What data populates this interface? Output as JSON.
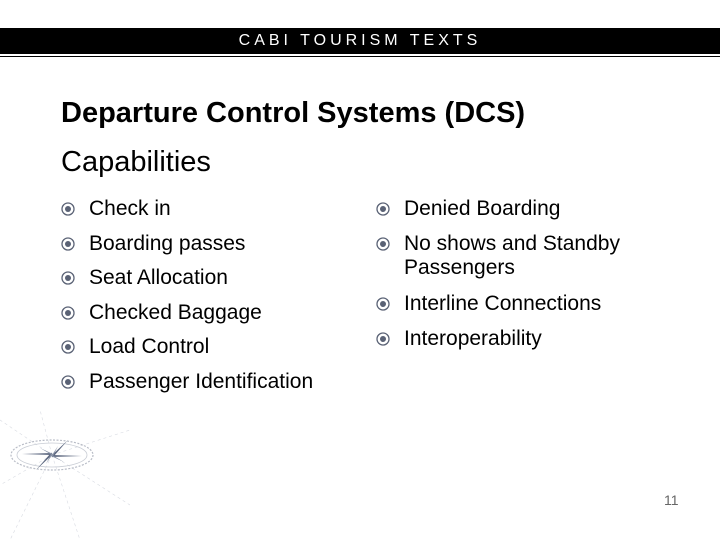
{
  "header": {
    "banner": "CABI TOURISM TEXTS"
  },
  "slide": {
    "title": "Departure Control Systems (DCS)",
    "subtitle": "Capabilities",
    "left_items": [
      "Check in",
      "Boarding passes",
      "Seat Allocation",
      "Checked Baggage",
      "Load Control",
      "Passenger Identification"
    ],
    "right_items": [
      {
        "line1": "Denied Boarding",
        "line2": ""
      },
      {
        "line1": "No shows and Standby",
        "line2": "Passengers"
      },
      {
        "line1": "Interline Connections",
        "line2": ""
      },
      {
        "line1": "Interoperability",
        "line2": ""
      }
    ],
    "bullet_icon": "circled-dot-icon",
    "decoration_icon": "compass-rose-icon",
    "page_number": "11"
  },
  "colors": {
    "banner_bg": "#000000",
    "banner_text": "#ffffff",
    "bullet": "#5a6275"
  }
}
